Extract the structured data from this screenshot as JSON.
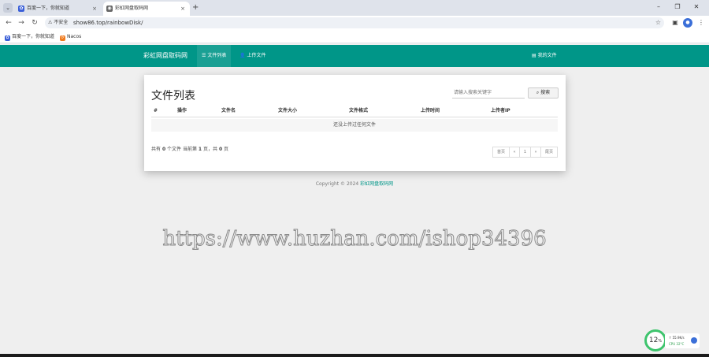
{
  "browser": {
    "tabs": [
      {
        "title": "百度一下，你就知道",
        "close": "×"
      },
      {
        "title": "彩虹网盘取码网",
        "close": "×"
      }
    ],
    "tab_menu_glyph": "⌄",
    "new_tab": "+",
    "window": {
      "min": "–",
      "max": "❐",
      "close": "✕"
    },
    "nav": {
      "back": "←",
      "forward": "→",
      "reload": "↻"
    },
    "security": "⚠ 不安全",
    "url": "show86.top/rainbowDisk/",
    "star": "☆",
    "avatar_glyph": "●",
    "more": "⋮",
    "bookmarks": [
      {
        "label": "百度一下，你就知道",
        "icon": "baidu-icon",
        "icon_glyph": "✿"
      },
      {
        "label": "Nacos",
        "icon": "nacos-icon",
        "icon_glyph": "⟳"
      }
    ],
    "colors": {
      "tabstrip": "#dfe3eb",
      "omnibox": "#eef1f6"
    }
  },
  "navbar": {
    "brand": "彩虹网盘取码网",
    "items": [
      {
        "label": "文件列表",
        "icon": "list-icon",
        "glyph": "☰",
        "active": true
      },
      {
        "label": "上传文件",
        "icon": "user-icon",
        "glyph": "👤",
        "active": false
      }
    ],
    "my_files": {
      "label": "我的文件",
      "icon": "folder-icon",
      "glyph": "▤"
    },
    "color": "#009688"
  },
  "panel": {
    "title": "文件列表",
    "search_placeholder": "请输入搜索关键字",
    "search_button": "搜索",
    "search_glyph": "🔍",
    "columns": [
      "#",
      "操作",
      "文件名",
      "文件大小",
      "文件格式",
      "上传时间",
      "上传者IP"
    ],
    "empty_text": "还没上传过任何文件",
    "summary": {
      "prefix": "共有",
      "count": "0",
      "mid1": "个文件  当前第",
      "page": "1",
      "mid2": "页，共",
      "total": "0",
      "suffix": "页"
    },
    "pager": [
      "首页",
      "«",
      "1",
      "»",
      "尾页"
    ]
  },
  "footer": {
    "prefix": "Copyright © 2024",
    "link": "彩虹网盘取码网"
  },
  "watermark": "https://www.huzhan.com/ishop34396",
  "cpu_widget": {
    "percent": "12",
    "unit": "%",
    "line1": "↑ 55.9K/s",
    "line2": "CPU 32°C"
  }
}
